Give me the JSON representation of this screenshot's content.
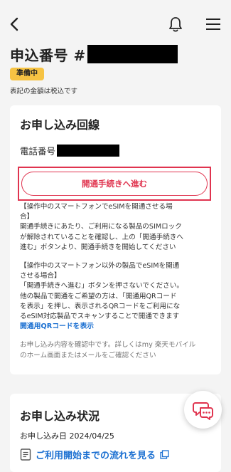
{
  "header": {
    "back_icon": "back-chevron-icon",
    "bell_icon": "bell-icon",
    "menu_icon": "hamburger-menu-icon",
    "title": "申込番号 #"
  },
  "status": {
    "badge": "準備中",
    "badge_color": "#f6c343"
  },
  "tax_note": "表記の金額は税込です",
  "line_card": {
    "title": "お申し込み回線",
    "phone_label": "電話番号",
    "proceed_button": "開通手続きへ進む",
    "accent_color": "#e0344f",
    "info_lines_1": [
      "【操作中のスマートフォンでeSIMを開通させる場",
      "合】",
      "開通手続きにあたり、ご利用になる製品のSIMロック",
      "が解除されていることを確認し、上の「開通手続きへ",
      "進む」ボタンより、開通手続きを開始してください"
    ],
    "info_lines_2": [
      "【操作中のスマートフォン以外の製品でeSIMを開通",
      "させる場合】",
      "「開通手続きへ進む」ボタンを押さないでください。",
      "他の製品で開通をご希望の方は、「開通用QRコード",
      "を表示」を押し、表示されるQRコードをご利用にな",
      "るeSIM対応製品でスキャンすることで開通できます"
    ],
    "qr_link": "開通用QRコードを表示",
    "confirm_lines": [
      "お申し込み内容を確認中です。詳しくはmy 楽天モバイル",
      "のホーム画面またはメールをご確認ください"
    ]
  },
  "status_card": {
    "title": "お申し込み状況",
    "date_label": "お申し込み日",
    "date": "2024/04/25",
    "flow_link": "ご利用開始までの流れを見る",
    "link_color": "#1a6fd1"
  },
  "chat": {
    "icon": "chat-bubbles-icon"
  }
}
